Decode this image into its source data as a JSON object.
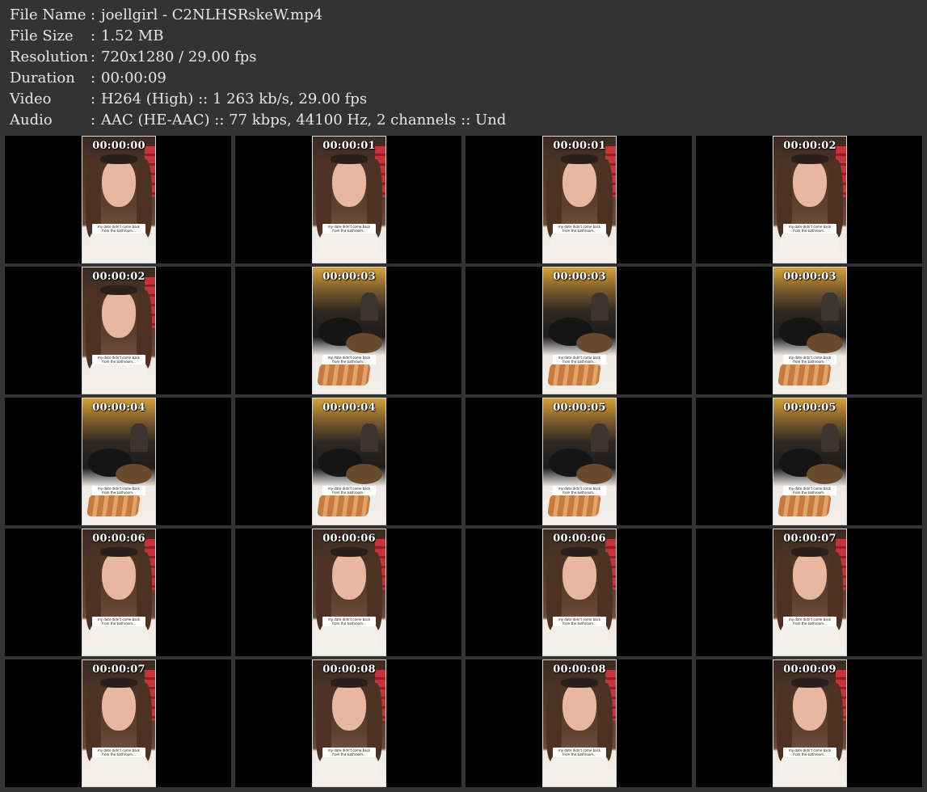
{
  "metadata": [
    {
      "key": "File Name",
      "sep": ":",
      "value": "joellgirl - C2NLHSRskeW.mp4"
    },
    {
      "key": "File Size",
      "sep": ":",
      "value": "1.52 MB"
    },
    {
      "key": "Resolution",
      "sep": ":",
      "value": "720x1280 / 29.00 fps"
    },
    {
      "key": "Duration",
      "sep": ":",
      "value": "00:00:09"
    },
    {
      "key": "Video",
      "sep": ":",
      "value": "H264 (High) :: 1 263 kb/s, 29.00 fps"
    },
    {
      "key": "Audio",
      "sep": ":",
      "value": "AAC (HE-AAC) :: 77 kbps, 44100 Hz, 2 channels :: Und"
    }
  ],
  "caption_text": "my date didn't come back\nfrom the bathroom...",
  "thumbnails": [
    {
      "time": "00:00:00",
      "scene": "face"
    },
    {
      "time": "00:00:01",
      "scene": "face"
    },
    {
      "time": "00:00:01",
      "scene": "face"
    },
    {
      "time": "00:00:02",
      "scene": "face"
    },
    {
      "time": "00:00:02",
      "scene": "face"
    },
    {
      "time": "00:00:03",
      "scene": "food"
    },
    {
      "time": "00:00:03",
      "scene": "food"
    },
    {
      "time": "00:00:03",
      "scene": "food"
    },
    {
      "time": "00:00:04",
      "scene": "food"
    },
    {
      "time": "00:00:04",
      "scene": "food"
    },
    {
      "time": "00:00:05",
      "scene": "food"
    },
    {
      "time": "00:00:05",
      "scene": "food"
    },
    {
      "time": "00:00:06",
      "scene": "face"
    },
    {
      "time": "00:00:06",
      "scene": "face"
    },
    {
      "time": "00:00:06",
      "scene": "face"
    },
    {
      "time": "00:00:07",
      "scene": "face"
    },
    {
      "time": "00:00:07",
      "scene": "face"
    },
    {
      "time": "00:00:08",
      "scene": "face"
    },
    {
      "time": "00:00:08",
      "scene": "face"
    },
    {
      "time": "00:00:09",
      "scene": "face"
    }
  ]
}
